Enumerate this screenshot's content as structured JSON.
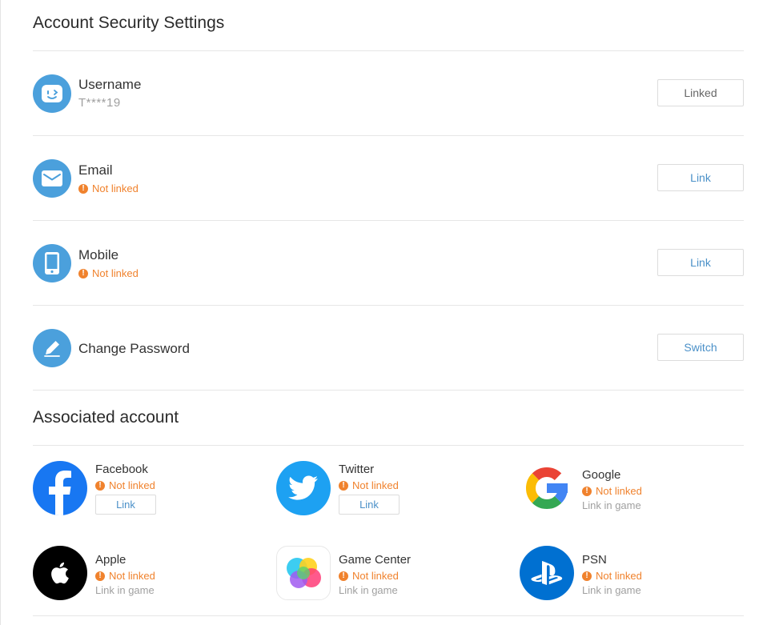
{
  "page": {
    "title": "Account Security Settings",
    "associated_title": "Associated account"
  },
  "security_rows": [
    {
      "icon": "smiley-face-icon",
      "label": "Username",
      "value": "T****19",
      "button": "Linked"
    },
    {
      "icon": "envelope-icon",
      "label": "Email",
      "status": "Not linked",
      "button": "Link"
    },
    {
      "icon": "mobile-phone-icon",
      "label": "Mobile",
      "status": "Not linked",
      "button": "Link"
    },
    {
      "icon": "pencil-icon",
      "label": "Change Password",
      "button": "Switch"
    }
  ],
  "associated_accounts": [
    {
      "icon": "facebook-icon",
      "name": "Facebook",
      "status": "Not linked",
      "button": "Link"
    },
    {
      "icon": "twitter-icon",
      "name": "Twitter",
      "status": "Not linked",
      "button": "Link"
    },
    {
      "icon": "google-icon",
      "name": "Google",
      "status": "Not linked",
      "hint": "Link in game"
    },
    {
      "icon": "apple-icon",
      "name": "Apple",
      "status": "Not linked",
      "hint": "Link in game"
    },
    {
      "icon": "game-center-icon",
      "name": "Game Center",
      "status": "Not linked",
      "hint": "Link in game"
    },
    {
      "icon": "playstation-icon",
      "name": "PSN",
      "status": "Not linked",
      "hint": "Link in game"
    }
  ],
  "colors": {
    "accent_blue": "#4ba0dc",
    "warning_orange": "#f0822d",
    "button_text_blue": "#4a90c8",
    "facebook_blue": "#1877f2",
    "twitter_blue": "#1da1f2",
    "psn_blue": "#0070d1"
  }
}
